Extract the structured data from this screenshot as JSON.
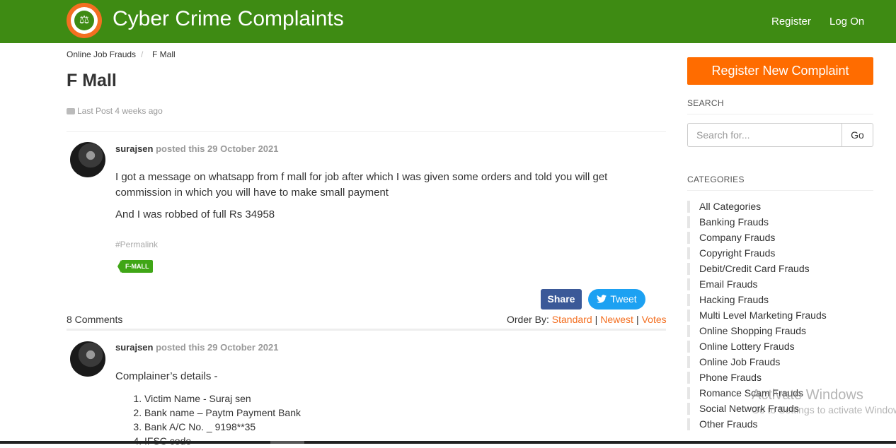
{
  "header": {
    "site_title": "Cyber Crime Complaints",
    "logo_icon": "scales-of-justice-icon",
    "nav": {
      "register": "Register",
      "login": "Log On"
    }
  },
  "breadcrumb": {
    "category": "Online Job Frauds",
    "separator": "/",
    "current": "F Mall"
  },
  "page_title": "F Mall",
  "last_post": "Last Post 4 weeks ago",
  "post": {
    "author": "surajsen",
    "meta": "posted this 29 October 2021",
    "paragraph1": "I got a message on whatsapp from f mall for job after which I was given some orders and told you will get commission in which you will have to make small payment",
    "paragraph2": "And I was robbed of full Rs 34958",
    "permalink": "#Permalink",
    "tag": "F-MALL",
    "share_label": "Share",
    "tweet_label": "Tweet"
  },
  "comments": {
    "count_label": "8 Comments",
    "order_by_label": "Order By:",
    "order_options": [
      "Standard",
      "Newest",
      "Votes"
    ]
  },
  "comment1": {
    "author": "surajsen",
    "meta": "posted this 29 October 2021",
    "intro": "Complainer’s details -",
    "items": [
      "Victim Name - Suraj sen",
      "Bank name – Paytm Payment Bank",
      "Bank A/C No. _ 9198**35",
      "IFSC code"
    ]
  },
  "sidebar": {
    "register_button": "Register New Complaint",
    "search_heading": "SEARCH",
    "search_placeholder": "Search for...",
    "search_button": "Go",
    "categories_heading": "CATEGORIES",
    "categories": [
      "All Categories",
      "Banking Frauds",
      "Company Frauds",
      "Copyright Frauds",
      "Debit/Credit Card Frauds",
      "Email Frauds",
      "Hacking Frauds",
      "Multi Level Marketing Frauds",
      "Online Shopping Frauds",
      "Online Lottery Frauds",
      "Online Job Frauds",
      "Phone Frauds",
      "Romance Scam Frauds",
      "Social Network Frauds",
      "Other Frauds"
    ]
  },
  "watermark": {
    "line1": "Activate Windows",
    "line2": "Go to Settings to activate Windows."
  },
  "colors": {
    "header_green": "#3e8b13",
    "accent_orange": "#ff6c00",
    "tag_green": "#3fa616",
    "facebook": "#3b5998",
    "twitter": "#1da1f2"
  }
}
